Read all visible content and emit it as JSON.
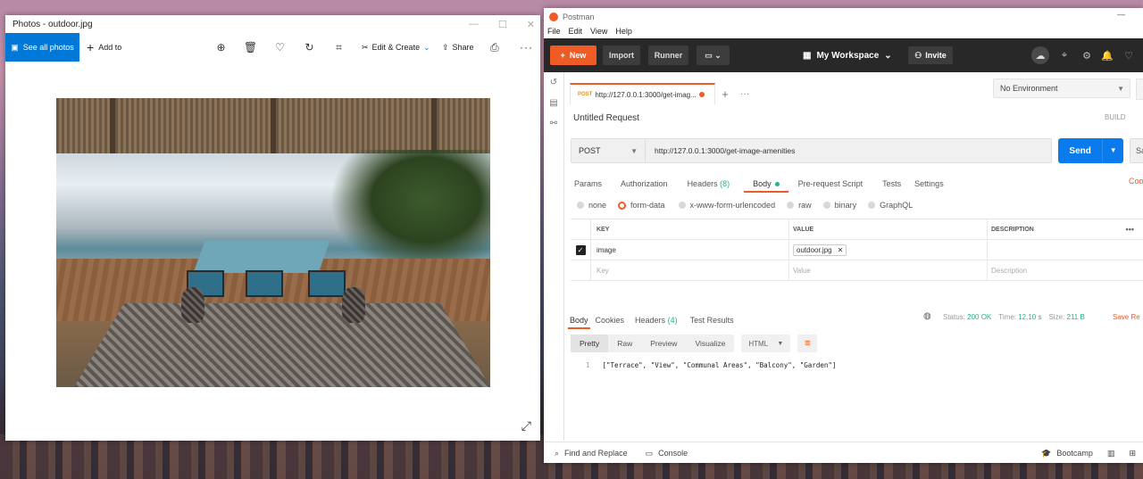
{
  "photos": {
    "title": "Photos - outdoor.jpg",
    "see_all": "See all photos",
    "add_to": "Add to",
    "edit_create": "Edit & Create",
    "share": "Share"
  },
  "postman": {
    "title": "Postman",
    "menu": [
      "File",
      "Edit",
      "View",
      "Help"
    ],
    "header": {
      "new": "New",
      "import": "Import",
      "runner": "Runner",
      "workspace": "My Workspace",
      "invite": "Invite"
    },
    "tab": {
      "method": "POST",
      "url": "http://127.0.0.1:3000/get-imag..."
    },
    "environment": "No Environment",
    "request_name": "Untitled Request",
    "build": "BUILD",
    "request": {
      "method": "POST",
      "url": "http://127.0.0.1:3000/get-image-amenities",
      "send": "Send",
      "save": "Sa"
    },
    "subtabs": {
      "params": "Params",
      "authorization": "Authorization",
      "headers": "Headers",
      "headers_count": "(8)",
      "body": "Body",
      "prerequest": "Pre-request Script",
      "tests": "Tests",
      "settings": "Settings",
      "cookies": "Coo"
    },
    "body_types": [
      "none",
      "form-data",
      "x-www-form-urlencoded",
      "raw",
      "binary",
      "GraphQL"
    ],
    "kv": {
      "col_key": "KEY",
      "col_value": "VALUE",
      "col_desc": "DESCRIPTION",
      "row_key": "image",
      "row_value": "outdoor.jpg",
      "ph_key": "Key",
      "ph_value": "Value",
      "ph_desc": "Description"
    },
    "response": {
      "body": "Body",
      "cookies": "Cookies",
      "headers": "Headers",
      "headers_count": "(4)",
      "test_results": "Test Results",
      "status_label": "Status:",
      "status": "200 OK",
      "time_label": "Time:",
      "time": "12.10 s",
      "size_label": "Size:",
      "size": "211 B",
      "save": "Save Re"
    },
    "formats": {
      "pretty": "Pretty",
      "raw": "Raw",
      "preview": "Preview",
      "visualize": "Visualize",
      "lang": "HTML"
    },
    "code": {
      "line": "1",
      "text": "[\"Terrace\", \"View\", \"Communal Areas\", \"Balcony\", \"Garden\"]"
    },
    "footer": {
      "find": "Find and Replace",
      "console": "Console",
      "bootcamp": "Bootcamp"
    }
  },
  "colors": {
    "postman_orange": "#ef5b25",
    "send_blue": "#097bed",
    "photos_blue": "#0078d7",
    "status_green": "#26b47f"
  }
}
